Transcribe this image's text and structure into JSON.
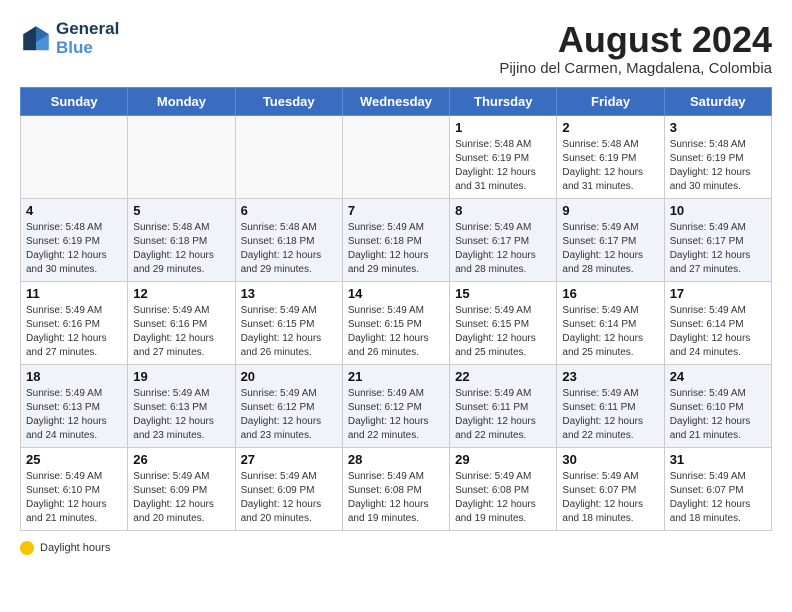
{
  "header": {
    "logo_line1": "General",
    "logo_line2": "Blue",
    "month_year": "August 2024",
    "location": "Pijino del Carmen, Magdalena, Colombia"
  },
  "footer": {
    "label": "Daylight hours"
  },
  "days_of_week": [
    "Sunday",
    "Monday",
    "Tuesday",
    "Wednesday",
    "Thursday",
    "Friday",
    "Saturday"
  ],
  "weeks": [
    [
      {
        "day": "",
        "info": ""
      },
      {
        "day": "",
        "info": ""
      },
      {
        "day": "",
        "info": ""
      },
      {
        "day": "",
        "info": ""
      },
      {
        "day": "1",
        "info": "Sunrise: 5:48 AM\nSunset: 6:19 PM\nDaylight: 12 hours\nand 31 minutes."
      },
      {
        "day": "2",
        "info": "Sunrise: 5:48 AM\nSunset: 6:19 PM\nDaylight: 12 hours\nand 31 minutes."
      },
      {
        "day": "3",
        "info": "Sunrise: 5:48 AM\nSunset: 6:19 PM\nDaylight: 12 hours\nand 30 minutes."
      }
    ],
    [
      {
        "day": "4",
        "info": "Sunrise: 5:48 AM\nSunset: 6:19 PM\nDaylight: 12 hours\nand 30 minutes."
      },
      {
        "day": "5",
        "info": "Sunrise: 5:48 AM\nSunset: 6:18 PM\nDaylight: 12 hours\nand 29 minutes."
      },
      {
        "day": "6",
        "info": "Sunrise: 5:48 AM\nSunset: 6:18 PM\nDaylight: 12 hours\nand 29 minutes."
      },
      {
        "day": "7",
        "info": "Sunrise: 5:49 AM\nSunset: 6:18 PM\nDaylight: 12 hours\nand 29 minutes."
      },
      {
        "day": "8",
        "info": "Sunrise: 5:49 AM\nSunset: 6:17 PM\nDaylight: 12 hours\nand 28 minutes."
      },
      {
        "day": "9",
        "info": "Sunrise: 5:49 AM\nSunset: 6:17 PM\nDaylight: 12 hours\nand 28 minutes."
      },
      {
        "day": "10",
        "info": "Sunrise: 5:49 AM\nSunset: 6:17 PM\nDaylight: 12 hours\nand 27 minutes."
      }
    ],
    [
      {
        "day": "11",
        "info": "Sunrise: 5:49 AM\nSunset: 6:16 PM\nDaylight: 12 hours\nand 27 minutes."
      },
      {
        "day": "12",
        "info": "Sunrise: 5:49 AM\nSunset: 6:16 PM\nDaylight: 12 hours\nand 27 minutes."
      },
      {
        "day": "13",
        "info": "Sunrise: 5:49 AM\nSunset: 6:15 PM\nDaylight: 12 hours\nand 26 minutes."
      },
      {
        "day": "14",
        "info": "Sunrise: 5:49 AM\nSunset: 6:15 PM\nDaylight: 12 hours\nand 26 minutes."
      },
      {
        "day": "15",
        "info": "Sunrise: 5:49 AM\nSunset: 6:15 PM\nDaylight: 12 hours\nand 25 minutes."
      },
      {
        "day": "16",
        "info": "Sunrise: 5:49 AM\nSunset: 6:14 PM\nDaylight: 12 hours\nand 25 minutes."
      },
      {
        "day": "17",
        "info": "Sunrise: 5:49 AM\nSunset: 6:14 PM\nDaylight: 12 hours\nand 24 minutes."
      }
    ],
    [
      {
        "day": "18",
        "info": "Sunrise: 5:49 AM\nSunset: 6:13 PM\nDaylight: 12 hours\nand 24 minutes."
      },
      {
        "day": "19",
        "info": "Sunrise: 5:49 AM\nSunset: 6:13 PM\nDaylight: 12 hours\nand 23 minutes."
      },
      {
        "day": "20",
        "info": "Sunrise: 5:49 AM\nSunset: 6:12 PM\nDaylight: 12 hours\nand 23 minutes."
      },
      {
        "day": "21",
        "info": "Sunrise: 5:49 AM\nSunset: 6:12 PM\nDaylight: 12 hours\nand 22 minutes."
      },
      {
        "day": "22",
        "info": "Sunrise: 5:49 AM\nSunset: 6:11 PM\nDaylight: 12 hours\nand 22 minutes."
      },
      {
        "day": "23",
        "info": "Sunrise: 5:49 AM\nSunset: 6:11 PM\nDaylight: 12 hours\nand 22 minutes."
      },
      {
        "day": "24",
        "info": "Sunrise: 5:49 AM\nSunset: 6:10 PM\nDaylight: 12 hours\nand 21 minutes."
      }
    ],
    [
      {
        "day": "25",
        "info": "Sunrise: 5:49 AM\nSunset: 6:10 PM\nDaylight: 12 hours\nand 21 minutes."
      },
      {
        "day": "26",
        "info": "Sunrise: 5:49 AM\nSunset: 6:09 PM\nDaylight: 12 hours\nand 20 minutes."
      },
      {
        "day": "27",
        "info": "Sunrise: 5:49 AM\nSunset: 6:09 PM\nDaylight: 12 hours\nand 20 minutes."
      },
      {
        "day": "28",
        "info": "Sunrise: 5:49 AM\nSunset: 6:08 PM\nDaylight: 12 hours\nand 19 minutes."
      },
      {
        "day": "29",
        "info": "Sunrise: 5:49 AM\nSunset: 6:08 PM\nDaylight: 12 hours\nand 19 minutes."
      },
      {
        "day": "30",
        "info": "Sunrise: 5:49 AM\nSunset: 6:07 PM\nDaylight: 12 hours\nand 18 minutes."
      },
      {
        "day": "31",
        "info": "Sunrise: 5:49 AM\nSunset: 6:07 PM\nDaylight: 12 hours\nand 18 minutes."
      }
    ]
  ]
}
